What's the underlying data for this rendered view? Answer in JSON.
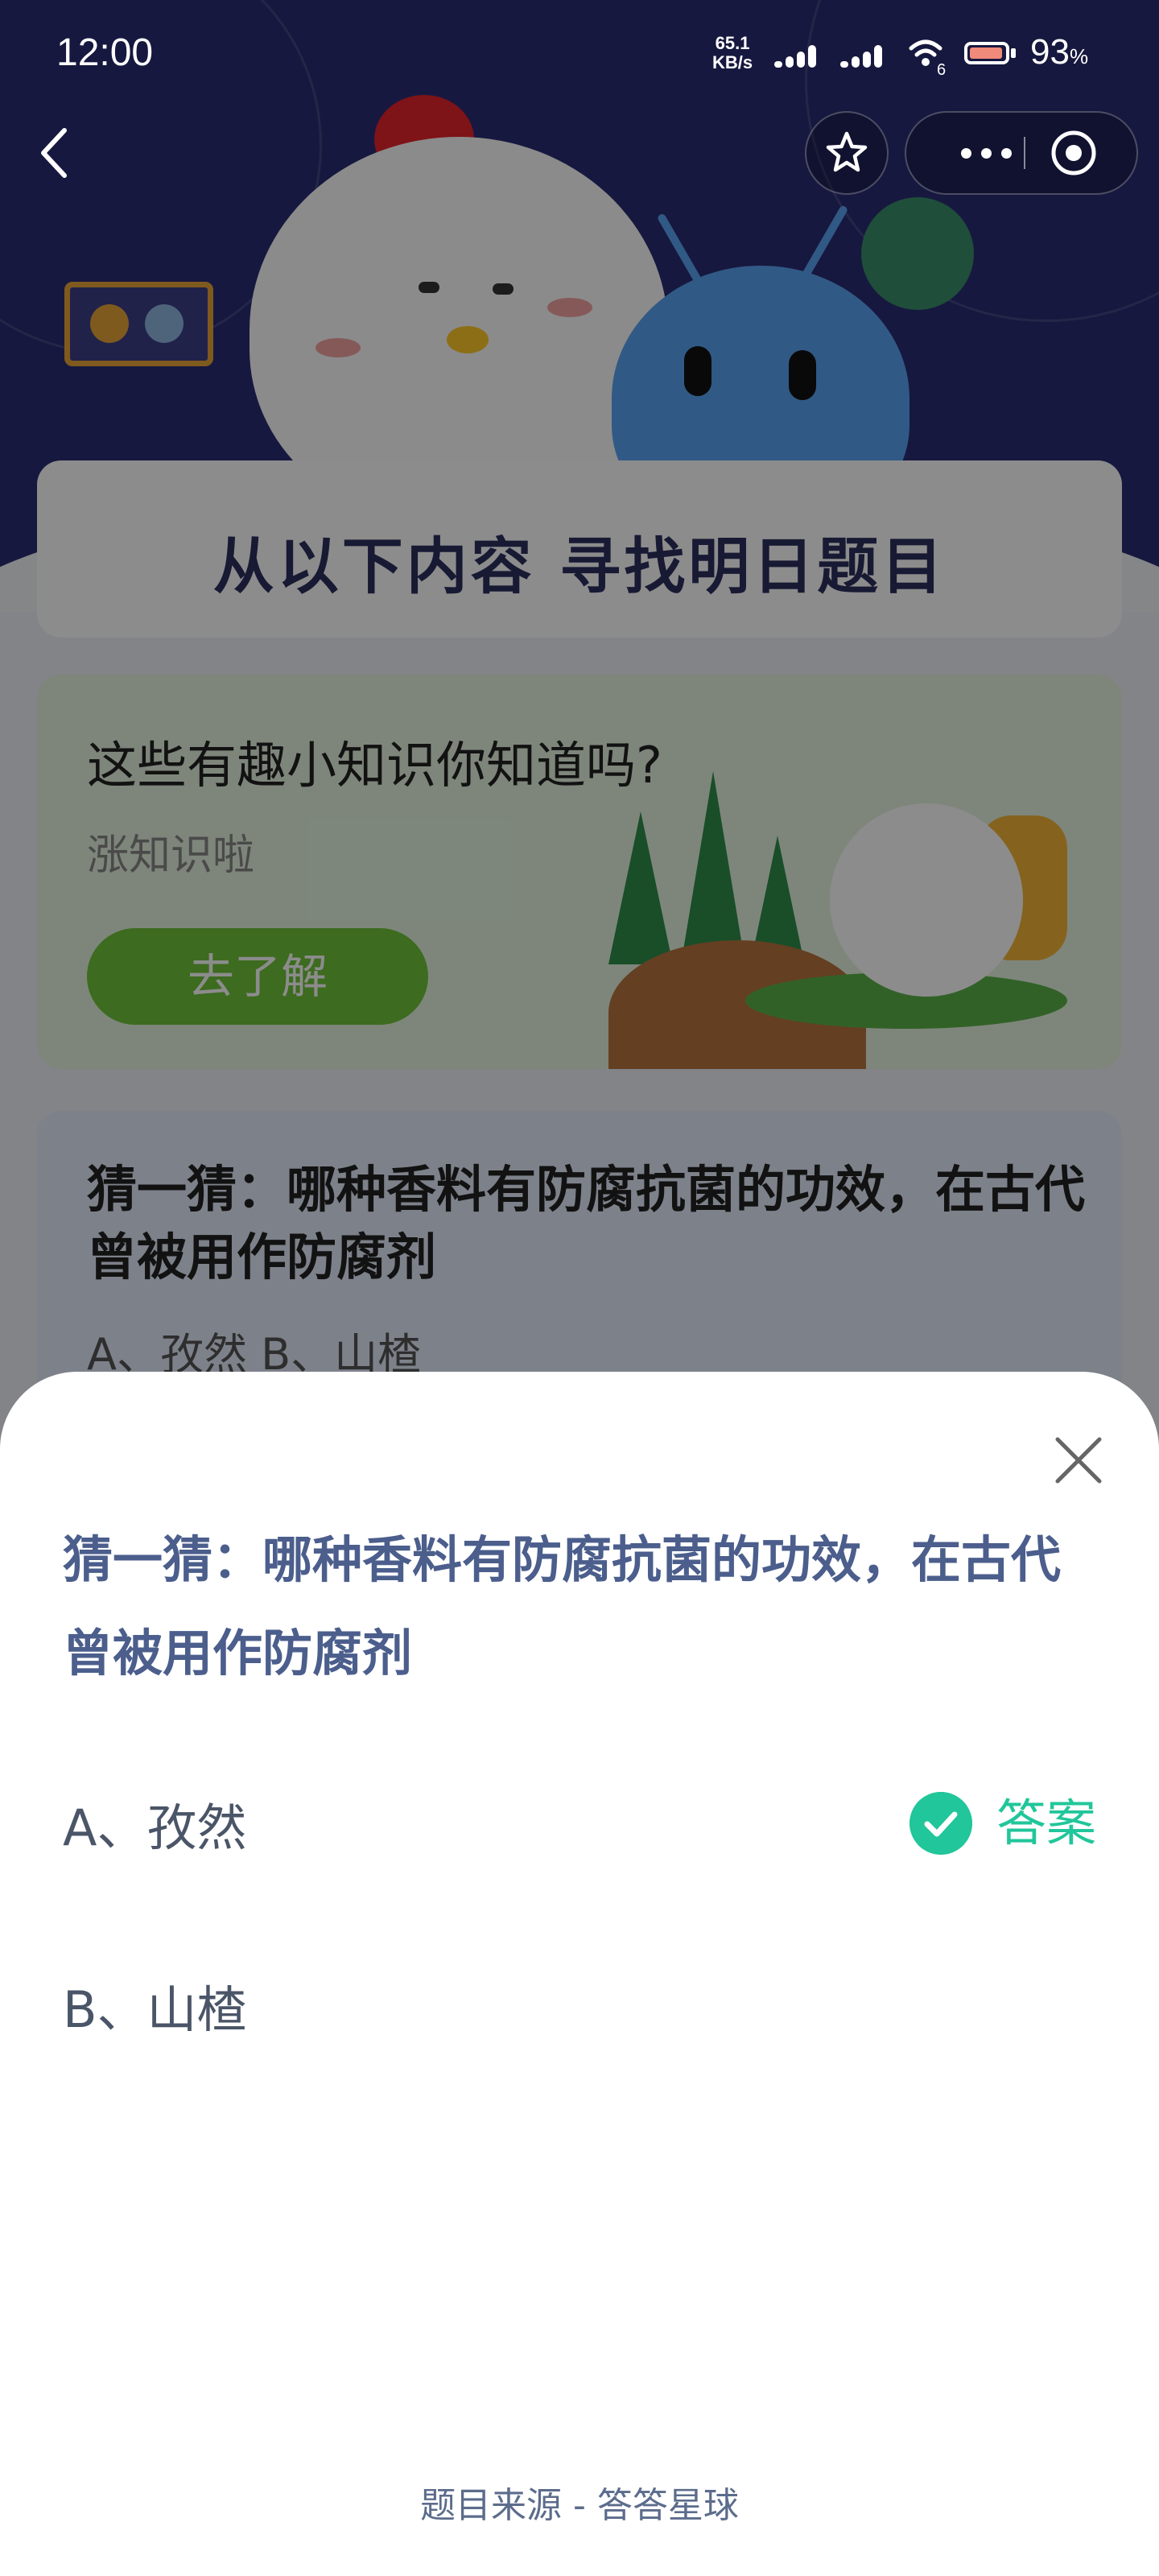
{
  "status_bar": {
    "time": "12:00",
    "net_speed_value": "65.1",
    "net_speed_unit": "KB/s",
    "wifi_badge": "6",
    "battery_percent": "93",
    "battery_unit": "%"
  },
  "background": {
    "banner_title": "从以下内容 寻找明日题目",
    "tips_card": {
      "title": "这些有趣小知识你知道吗?",
      "subtitle": "涨知识啦",
      "button_label": "去了解"
    },
    "quiz_card": {
      "question": "猜一猜：哪种香料有防腐抗菌的功效，在古代曾被用作防腐剂",
      "options_preview": "A、孜然    B、山楂"
    }
  },
  "sheet": {
    "question": "猜一猜：哪种香料有防腐抗菌的功效，在古代曾被用作防腐剂",
    "options": [
      {
        "label": "A、孜然",
        "is_answer": true
      },
      {
        "label": "B、山楂",
        "is_answer": false
      }
    ],
    "answer_label": "答案",
    "source": "题目来源 - 答答星球"
  },
  "colors": {
    "accent_green": "#21c69a",
    "question_text": "#4b5e8c",
    "hero_bg": "#2a2c74"
  }
}
